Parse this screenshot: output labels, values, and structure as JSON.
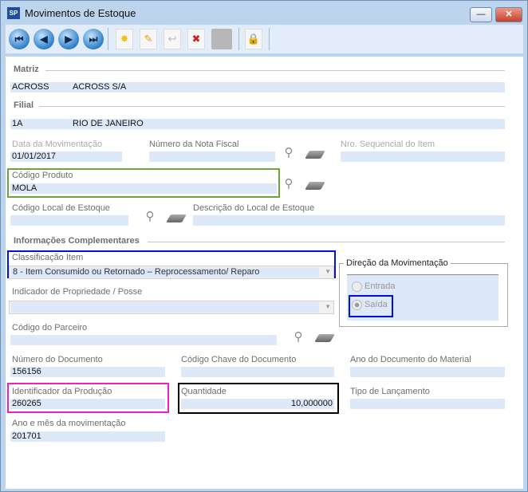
{
  "window": {
    "title": "Movimentos de Estoque",
    "logo": "SP",
    "minimize": "—",
    "close": "✕"
  },
  "toolbar": {
    "first": "⏮",
    "prev": "◀",
    "next": "▶",
    "last": "⏭"
  },
  "matriz": {
    "header": "Matriz",
    "code": "ACROSS",
    "name": "ACROSS S/A"
  },
  "filial": {
    "header": "Filial",
    "code": "1A",
    "name": "RIO DE JANEIRO"
  },
  "fields": {
    "data_mov": {
      "label": "Data da Movimentação",
      "value": "01/01/2017"
    },
    "nota_fiscal": {
      "label": "Número da Nota Fiscal",
      "value": ""
    },
    "nro_seq": {
      "label": "Nro. Sequencial do Item",
      "value": ""
    },
    "cod_produto": {
      "label": "Código Produto",
      "value": "MOLA"
    },
    "cod_local": {
      "label": "Código Local de Estoque",
      "value": ""
    },
    "desc_local": {
      "label": "Descrição do Local de Estoque",
      "value": ""
    },
    "classificacao": {
      "label": "Classificação Item",
      "value": "8 - Item Consumido ou Retornado – Reprocessamento/ Reparo"
    },
    "indicador": {
      "label": "Indicador de Propriedade / Posse",
      "value": ""
    },
    "cod_parceiro": {
      "label": "Código do Parceiro",
      "value": ""
    },
    "num_doc": {
      "label": "Número do Documento",
      "value": "156156"
    },
    "chave_doc": {
      "label": "Código Chave do Documento",
      "value": ""
    },
    "ano_doc": {
      "label": "Ano do Documento do Material",
      "value": ""
    },
    "ident_prod": {
      "label": "Identificador da Produção",
      "value": "260265"
    },
    "quantidade": {
      "label": "Quantidade",
      "value": "10,000000"
    },
    "tipo_lanc": {
      "label": "Tipo de Lançamento",
      "value": ""
    },
    "ano_mes": {
      "label": "Ano e mês da movimentação",
      "value": "201701"
    }
  },
  "info_header": "Informações Complementares",
  "direcao": {
    "title": "Direção da Movimentação",
    "entrada": "Entrada",
    "saida": "Saída",
    "selected": "Saída"
  },
  "highlights": {
    "green": "#6aa53a",
    "blue": "#0010e0",
    "pink": "#f020c0",
    "black": "#000000"
  }
}
